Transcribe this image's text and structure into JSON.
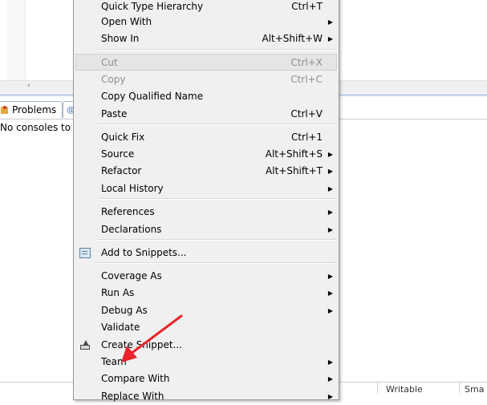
{
  "editor": {
    "scroll_left_glyph": "‹"
  },
  "views": {
    "problems_tab": "Problems",
    "console_tab_glyph": "@",
    "console_text": "No consoles to d"
  },
  "status": {
    "writable": "Writable",
    "smart": "Sma"
  },
  "menu": {
    "items": [
      {
        "label": "Quick Type Hierarchy",
        "accel": "Ctrl+T",
        "submenu": false
      },
      {
        "label": "Open With",
        "accel": "",
        "submenu": true
      },
      {
        "label": "Show In",
        "accel": "Alt+Shift+W",
        "submenu": true
      },
      {
        "label": "Cut",
        "accel": "Ctrl+X",
        "submenu": false,
        "disabled": true,
        "highlighted": true
      },
      {
        "label": "Copy",
        "accel": "Ctrl+C",
        "submenu": false,
        "disabled": true
      },
      {
        "label": "Copy Qualified Name",
        "accel": "",
        "submenu": false
      },
      {
        "label": "Paste",
        "accel": "Ctrl+V",
        "submenu": false
      },
      {
        "label": "Quick Fix",
        "accel": "Ctrl+1",
        "submenu": false
      },
      {
        "label": "Source",
        "accel": "Alt+Shift+S",
        "submenu": true
      },
      {
        "label": "Refactor",
        "accel": "Alt+Shift+T",
        "submenu": true
      },
      {
        "label": "Local History",
        "accel": "",
        "submenu": true
      },
      {
        "label": "References",
        "accel": "",
        "submenu": true
      },
      {
        "label": "Declarations",
        "accel": "",
        "submenu": true
      },
      {
        "label": "Add to Snippets...",
        "accel": "",
        "submenu": false,
        "icon": "snippet-icon"
      },
      {
        "label": "Coverage As",
        "accel": "",
        "submenu": true
      },
      {
        "label": "Run As",
        "accel": "",
        "submenu": true
      },
      {
        "label": "Debug As",
        "accel": "",
        "submenu": true
      },
      {
        "label": "Validate",
        "accel": "",
        "submenu": false
      },
      {
        "label": "Create Snippet...",
        "accel": "",
        "submenu": false,
        "icon": "create-snippet-icon"
      },
      {
        "label": "Team",
        "accel": "",
        "submenu": true
      },
      {
        "label": "Compare With",
        "accel": "",
        "submenu": true
      },
      {
        "label": "Replace With",
        "accel": "",
        "submenu": true
      }
    ],
    "submenu_glyph": "▶"
  },
  "annotation": {
    "arrow_color": "#e8242c"
  }
}
